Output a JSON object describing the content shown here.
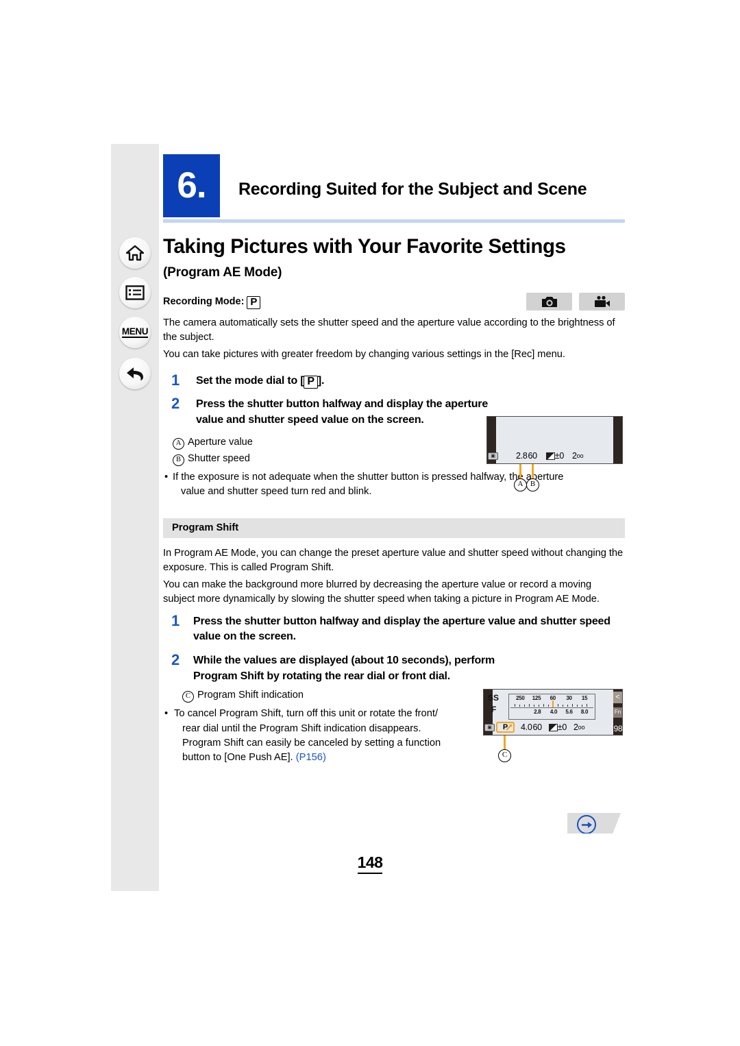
{
  "sidebar": {
    "items": [
      {
        "name": "home",
        "icon": "home-icon",
        "label": ""
      },
      {
        "name": "contents",
        "icon": "contents-list-icon",
        "label": ""
      },
      {
        "name": "menu",
        "icon": "menu-text-icon",
        "label": "MENU"
      },
      {
        "name": "back",
        "icon": "back-arrow-icon",
        "label": ""
      }
    ]
  },
  "chapter": {
    "number": "6.",
    "title": "Recording Suited for the Subject and Scene",
    "accent_color": "#0b3fb5",
    "rule_color": "#c3d5f0"
  },
  "heading": {
    "title": "Taking Pictures with Your Favorite Settings",
    "subtitle": "(Program AE Mode)"
  },
  "recording_mode": {
    "label": "Recording Mode:",
    "mode_key": "P",
    "icons": [
      {
        "name": "photo-mode-icon"
      },
      {
        "name": "video-mode-icon"
      }
    ]
  },
  "intro": {
    "paragraph1": "The camera automatically sets the shutter speed and the aperture value according to the brightness of the subject.",
    "paragraph2": "You can take pictures with greater freedom by changing various settings in the [Rec] menu."
  },
  "steps_main": [
    {
      "num": "1",
      "text_before": "Set the mode dial to [",
      "key": "P",
      "text_after": "]."
    },
    {
      "num": "2",
      "text": "Press the shutter button halfway and display the aperture value and shutter speed value on the screen."
    }
  ],
  "callouts_main": [
    {
      "letter": "A",
      "text": "Aperture value"
    },
    {
      "letter": "B",
      "text": "Shutter speed"
    }
  ],
  "note_main": {
    "line1": "If the exposure is not adequate when the shutter button is pressed halfway, the aperture",
    "line2": "value and shutter speed turn red and blink."
  },
  "program_shift": {
    "band_title": "Program Shift",
    "paragraph1": "In Program AE Mode, you can change the preset aperture value and shutter speed without changing the exposure. This is called Program Shift.",
    "paragraph2": "You can make the background more blurred by decreasing the aperture value or record a moving subject more dynamically by slowing the shutter speed when taking a picture in Program AE Mode.",
    "steps": [
      {
        "num": "1",
        "text": "Press the shutter button halfway and display the aperture value and shutter speed value on the screen."
      },
      {
        "num": "2",
        "text": "While the values are displayed (about 10 seconds), perform Program Shift by rotating the rear dial or front dial."
      }
    ],
    "callout": {
      "letter": "C",
      "text": "Program Shift indication"
    },
    "note": {
      "line1": "To cancel Program Shift, turn off this unit or rotate the front/",
      "line2": "rear dial until the Program Shift indication disappears.",
      "line3": "Program Shift can easily be canceled by setting a function",
      "line4_before": "button to [One Push AE]. ",
      "link": "(P156)",
      "link_color": "#1a55c8"
    }
  },
  "screen1": {
    "metering_icon": "metering-mode-icon",
    "aperture": "2.8",
    "shutter": "60",
    "ev_icon": "exposure-comp-icon",
    "ev_value": "±0",
    "iso_prefix": "2",
    "iso_suffix": "oo",
    "leader_labels": [
      "A",
      "B"
    ]
  },
  "screen2": {
    "row_labels": {
      "ss": "SS",
      "f": "F"
    },
    "ss_ticks": [
      "250",
      "125",
      "60",
      "30",
      "15"
    ],
    "f_ticks": [
      "2.8",
      "4.0",
      "5.6",
      "8.0"
    ],
    "metering_icon": "metering-mode-icon",
    "program_shift_indicator": "P",
    "aperture": "4.0",
    "shutter": "60",
    "ev_icon": "exposure-comp-icon",
    "ev_value": "±0",
    "iso_prefix": "2",
    "iso_suffix": "oo",
    "tab_chevron": "<",
    "tab_fn": "Fn",
    "shots_remaining": "98",
    "leader_label": "C"
  },
  "footer": {
    "next_icon": "next-page-arrow-icon",
    "page_number": "148"
  }
}
